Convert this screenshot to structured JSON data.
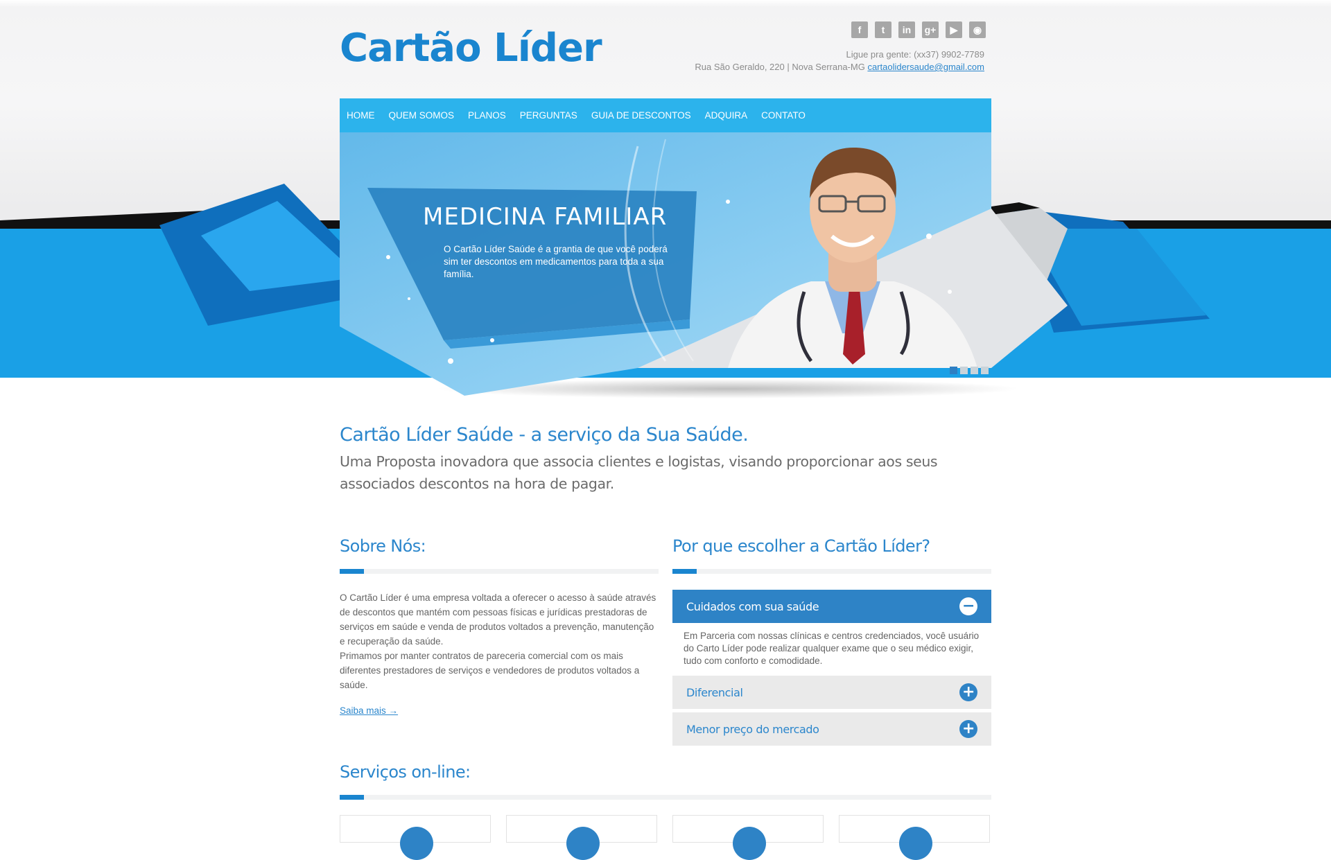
{
  "brand": {
    "logo": "Cartão Líder",
    "accent": "#2b86cc",
    "nav_color": "#2cb3ec"
  },
  "social": [
    "facebook-icon",
    "twitter-icon",
    "linkedin-icon",
    "google-plus-icon",
    "youtube-icon",
    "rss-icon"
  ],
  "contact": {
    "phone": "Ligue pra gente: (xx37) 9902-7789",
    "address": "Rua São Geraldo, 220 | Nova Serrana-MG ",
    "email": "cartaolidersaude@gmail.com"
  },
  "nav": [
    "HOME",
    "QUEM SOMOS",
    "PLANOS",
    "PERGUNTAS",
    "GUIA DE DESCONTOS",
    "ADQUIRA",
    "CONTATO"
  ],
  "slider": {
    "title": "MEDICINA FAMILIAR",
    "text": "O Cartão Líder Saúde é a grantia de que você poderá sim ter descontos em medicamentos para toda a sua família.",
    "slides": 4,
    "active": 1
  },
  "intro": {
    "title": "Cartão Líder Saúde - a serviço da Sua Saúde.",
    "subtitle": "Uma Proposta inovadora que associa clientes e logistas, visando proporcionar aos seus associados descontos na hora de pagar."
  },
  "about": {
    "heading": "Sobre Nós:",
    "p1": "O Cartão Líder é uma empresa voltada a oferecer o acesso à saúde através de descontos que mantém com pessoas físicas e jurídicas prestadoras de serviços em saúde e venda de produtos voltados a prevenção, manutenção e recuperação da saúde.",
    "p2": "Primamos por manter contratos de pareceria comercial com os mais diferentes prestadores de serviços e vendedores de produtos voltados a saúde.",
    "more": "Saiba mais →"
  },
  "why": {
    "heading": "Por que escolher a Cartão Líder?",
    "items": [
      {
        "title": "Cuidados com sua saúde",
        "open": true,
        "body": "Em Parceria com nossas clínicas e centros credenciados, você usuário do Carto Líder pode realizar qualquer exame que o seu médico exigir, tudo com conforto e comodidade."
      },
      {
        "title": "Diferencial",
        "open": false
      },
      {
        "title": "Menor preço do mercado",
        "open": false
      }
    ],
    "open_icon": "−",
    "closed_icon": "+"
  },
  "services": {
    "heading": "Serviços on-line:",
    "count": 4
  }
}
